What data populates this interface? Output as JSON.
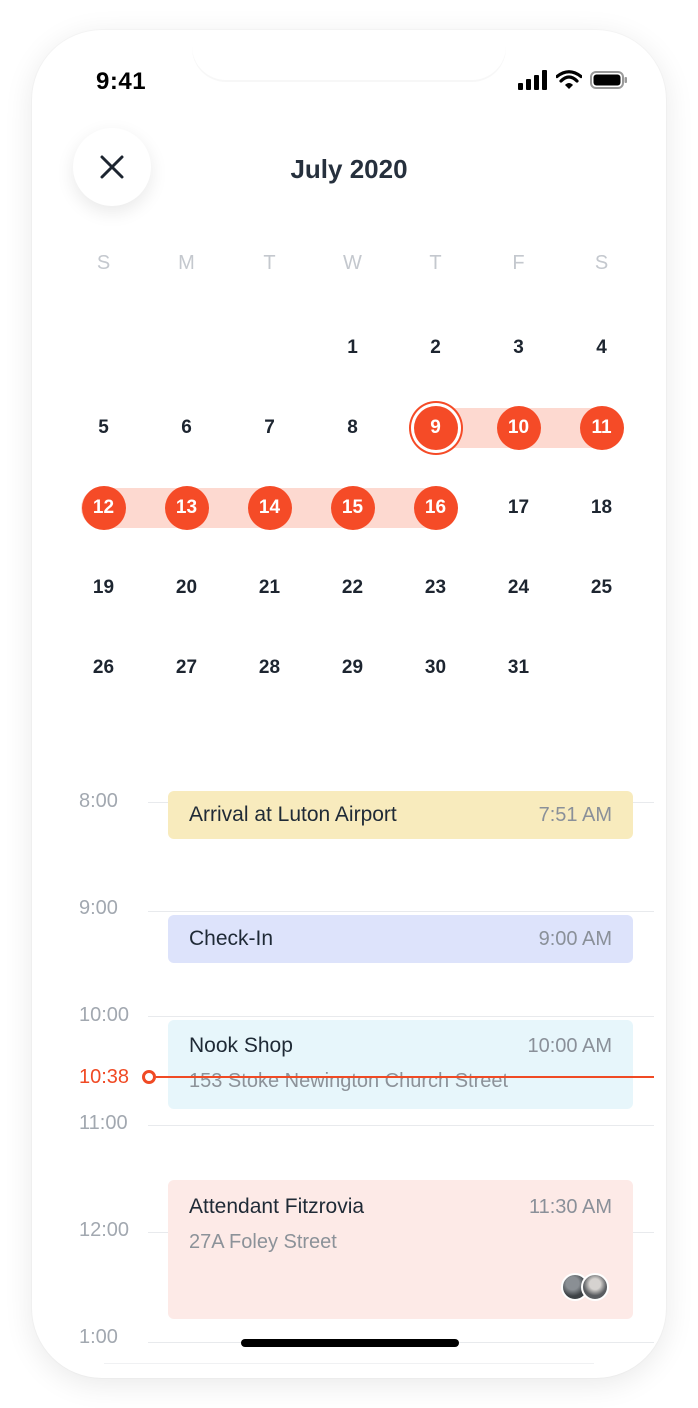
{
  "status_bar": {
    "time": "9:41"
  },
  "header": {
    "month_title": "July 2020",
    "close_icon": "close-icon"
  },
  "calendar": {
    "weekdays": [
      "S",
      "M",
      "T",
      "W",
      "T",
      "F",
      "S"
    ],
    "weeks": [
      [
        "",
        "",
        "",
        "1",
        "2",
        "3",
        "4"
      ],
      [
        "5",
        "6",
        "7",
        "8",
        "9",
        "10",
        "11"
      ],
      [
        "12",
        "13",
        "14",
        "15",
        "16",
        "17",
        "18"
      ],
      [
        "19",
        "20",
        "21",
        "22",
        "23",
        "24",
        "25"
      ],
      [
        "26",
        "27",
        "28",
        "29",
        "30",
        "31",
        ""
      ]
    ],
    "today": "9",
    "selected_range": [
      "9",
      "10",
      "11",
      "12",
      "13",
      "14",
      "15",
      "16"
    ],
    "accent_color": "#f54b27",
    "range_color": "#fdd9d0"
  },
  "timeline": {
    "hours": [
      "8:00",
      "9:00",
      "10:00",
      "11:00",
      "12:00",
      "1:00"
    ],
    "now_label": "10:38",
    "events": [
      {
        "title": "Arrival at Luton Airport",
        "time": "7:51 AM",
        "address": "",
        "color": "#f8ebbd"
      },
      {
        "title": "Check-In",
        "time": "9:00 AM",
        "address": "",
        "color": "#dde3fb"
      },
      {
        "title": "Nook Shop",
        "time": "10:00 AM",
        "address": "153 Stoke Newington Church Street",
        "color": "#e7f6fb"
      },
      {
        "title": "Attendant Fitzrovia",
        "time": "11:30 AM",
        "address": "27A Foley Street",
        "color": "#fdeae7"
      }
    ]
  }
}
